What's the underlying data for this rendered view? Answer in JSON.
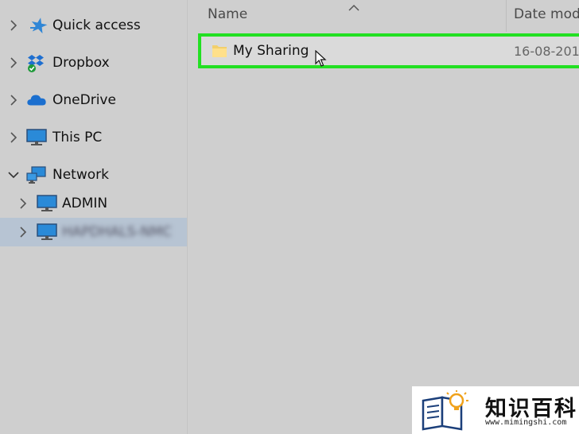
{
  "nav": {
    "items": [
      {
        "label": "Quick access",
        "icon": "star-icon",
        "expanded": false
      },
      {
        "label": "Dropbox",
        "icon": "dropbox-icon",
        "expanded": false
      },
      {
        "label": "OneDrive",
        "icon": "cloud-icon",
        "expanded": false
      },
      {
        "label": "This PC",
        "icon": "computer-icon",
        "expanded": false
      },
      {
        "label": "Network",
        "icon": "network-icon",
        "expanded": true
      },
      {
        "label": "ADMIN",
        "icon": "computer-icon",
        "expanded": false
      },
      {
        "label": "HAPDHALS-NMC",
        "icon": "computer-icon",
        "expanded": false,
        "selected": true,
        "blurred": true
      }
    ]
  },
  "content": {
    "columns": {
      "name": "Name",
      "date": "Date modi"
    },
    "rows": [
      {
        "name": "My Sharing",
        "date": "16-08-201",
        "icon": "folder-icon",
        "highlighted": true
      }
    ]
  },
  "watermark": {
    "title": "知识百科",
    "url": "www.mimingshi.com"
  },
  "colors": {
    "highlight_border": "#22e022",
    "selection": "#b7c4d3",
    "background": "#cfcfcf"
  }
}
